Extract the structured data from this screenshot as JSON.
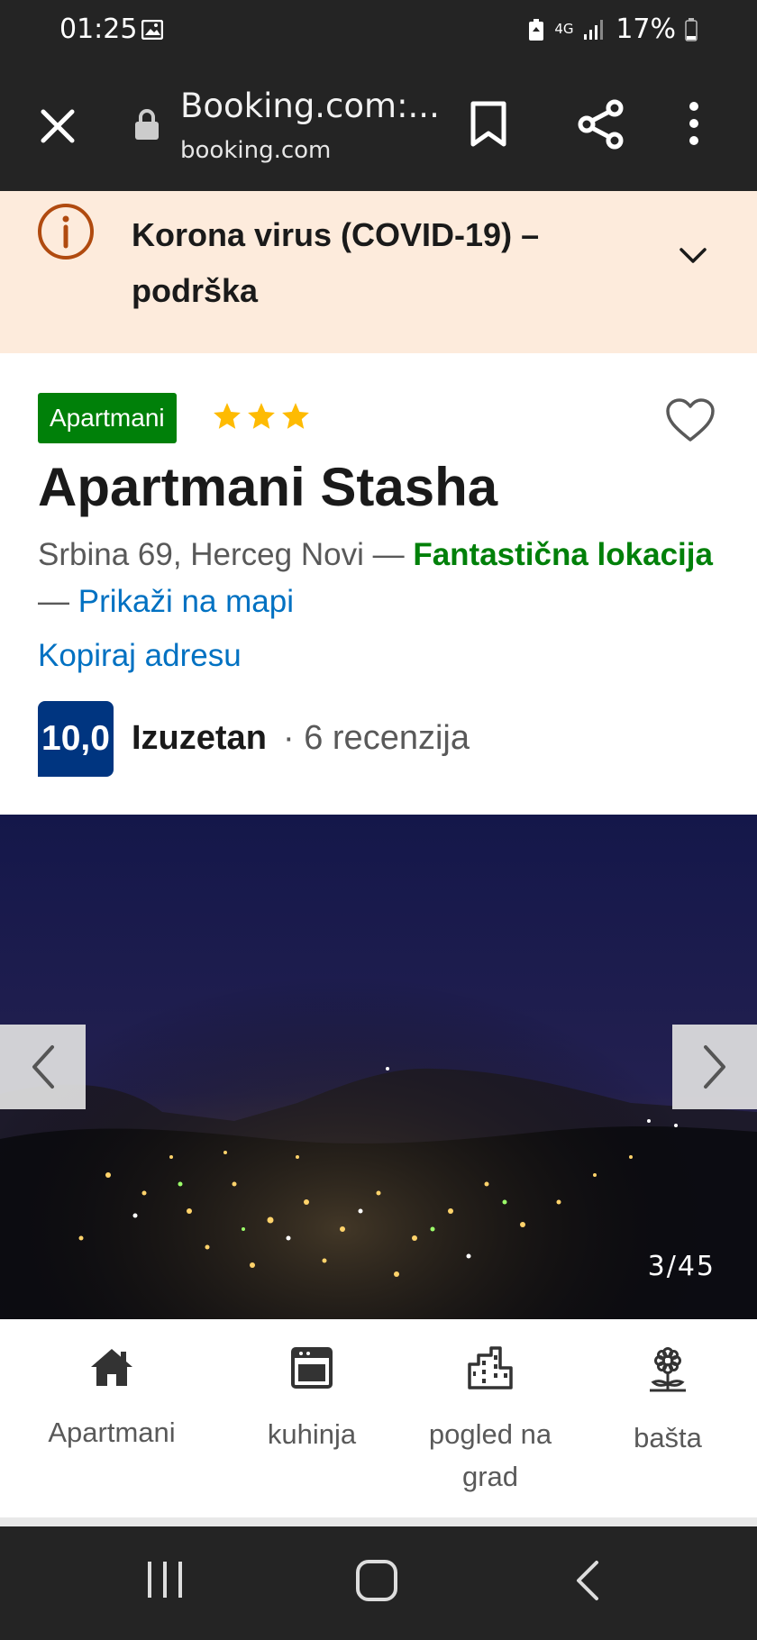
{
  "status_bar": {
    "time": "01:25",
    "network": "4G",
    "battery": "17%"
  },
  "browser": {
    "page_title": "Booking.com:...",
    "domain": "booking.com"
  },
  "covid_banner": {
    "title": "Korona virus (COVID-19) – podrška"
  },
  "property": {
    "type_badge": "Apartmani",
    "stars": 3,
    "name": "Apartmani Stasha",
    "address": "Srbina 69, Herceg Novi —",
    "location_rating": "Fantastična lokacija",
    "separator": "—",
    "show_on_map": "Prikaži na mapi",
    "copy_address": "Kopiraj adresu",
    "score": "10,0",
    "score_word": "Izuzetan",
    "reviews": "· 6 recenzija"
  },
  "gallery": {
    "counter": "3/45"
  },
  "facilities": [
    {
      "label": "Apartmani",
      "icon": "home-icon"
    },
    {
      "label": "kuhinja",
      "icon": "oven-icon"
    },
    {
      "label": "pogled na grad",
      "icon": "city-icon"
    },
    {
      "label": "bašta",
      "icon": "flower-icon"
    }
  ],
  "colors": {
    "brand_blue": "#003580",
    "link_blue": "#0071c2",
    "green": "#008009",
    "banner_bg": "#fdebdc",
    "star": "#febb02"
  }
}
